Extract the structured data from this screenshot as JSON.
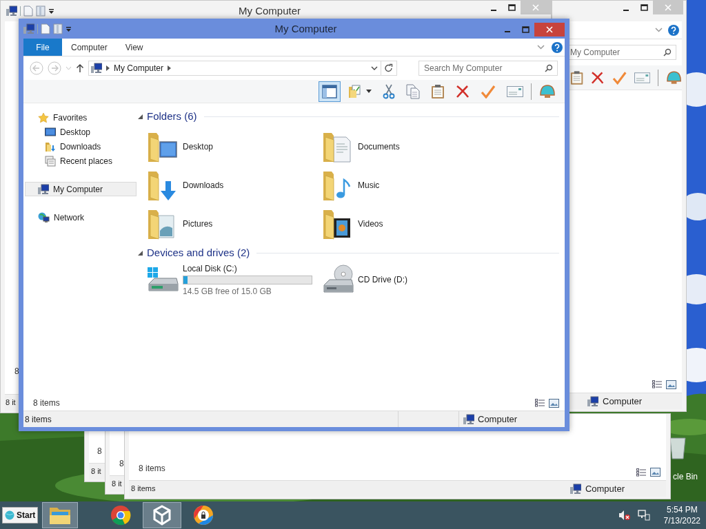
{
  "desktop": {
    "recycle_bin_label": "cle Bin"
  },
  "window_behind_left": {
    "title": "My Computer",
    "content_status": "8",
    "status": "8 it"
  },
  "window_behind_right": {
    "search_placeholder": "My Computer",
    "status_location": "Computer"
  },
  "windows_behind_bottom": [
    {
      "content_status": "8",
      "status": "8 it"
    },
    {
      "content_status": "8",
      "status": "8 it"
    },
    {
      "content_status": "8 items",
      "status": "8 items",
      "status_location": "Computer"
    }
  ],
  "window": {
    "title": "My Computer",
    "ribbon_tabs": [
      {
        "label": "File",
        "kind": "menu"
      },
      {
        "label": "Computer",
        "kind": "tab"
      },
      {
        "label": "View",
        "kind": "tab"
      }
    ],
    "address": {
      "location": "My Computer"
    },
    "search": {
      "placeholder": "Search My Computer"
    },
    "toolbar": [
      {
        "kind": "pane",
        "selected": true,
        "dropdown": false
      },
      {
        "kind": "folder",
        "selected": false,
        "dropdown": true
      },
      {
        "kind": "scissors",
        "selected": false,
        "dropdown": false
      },
      {
        "kind": "copy",
        "selected": false,
        "dropdown": false
      },
      {
        "kind": "paste",
        "selected": false,
        "dropdown": false
      },
      {
        "kind": "delete",
        "selected": false,
        "dropdown": false
      },
      {
        "kind": "check",
        "selected": false,
        "dropdown": false
      },
      {
        "kind": "envelope",
        "selected": false,
        "dropdown": false
      },
      {
        "kind": "shell",
        "selected": false,
        "dropdown": false
      }
    ],
    "sidebar": {
      "items": [
        {
          "label": "Favorites",
          "kind": "favorites",
          "selected": false,
          "children": [
            {
              "label": "Desktop",
              "kind": "desktop",
              "selected": false
            },
            {
              "label": "Downloads",
              "kind": "downloads",
              "selected": false
            },
            {
              "label": "Recent places",
              "kind": "recent",
              "selected": false
            }
          ]
        },
        {
          "label": "My Computer",
          "kind": "computer",
          "selected": true
        },
        {
          "label": "Network",
          "kind": "network",
          "selected": false
        }
      ]
    },
    "groups": [
      {
        "title": "Folders (6)",
        "expanded": true,
        "items": [
          {
            "name": "Desktop",
            "kind": "desktop"
          },
          {
            "name": "Documents",
            "kind": "documents"
          },
          {
            "name": "Downloads",
            "kind": "downloads"
          },
          {
            "name": "Music",
            "kind": "music"
          },
          {
            "name": "Pictures",
            "kind": "pictures"
          },
          {
            "name": "Videos",
            "kind": "videos"
          }
        ]
      },
      {
        "title": "Devices and drives (2)",
        "expanded": true,
        "items": [
          {
            "name": "Local Disk (C:)",
            "kind": "disk",
            "level": 0.033,
            "free": "14.5 GB free of 15.0 GB"
          },
          {
            "name": "CD Drive (D:)",
            "kind": "cd"
          }
        ]
      }
    ],
    "item_count": "8 items",
    "status_bar": {
      "count": "8 items",
      "location": "Computer"
    }
  },
  "taskbar": {
    "start_label": "Start",
    "apps": [
      {
        "kind": "explorer",
        "selected": true
      },
      {
        "kind": "chrome",
        "selected": false
      },
      {
        "kind": "unity",
        "selected": true
      },
      {
        "kind": "browser",
        "selected": false
      }
    ],
    "volume_muted": true,
    "time": "5:54 PM",
    "date": "7/13/2022"
  }
}
